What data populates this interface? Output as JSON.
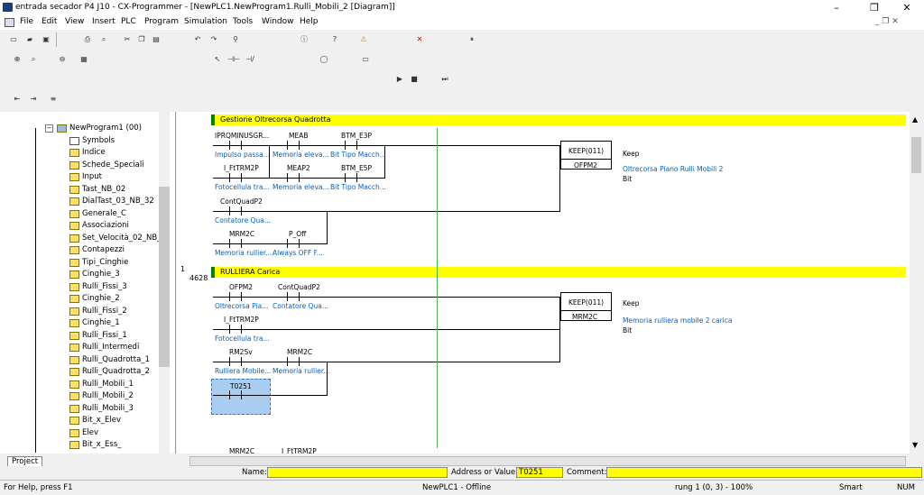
{
  "window": {
    "title": "entrada secador P4 J10 - CX-Programmer - [NewPLC1.NewProgram1.Rulli_Mobili_2 [Diagram]]",
    "controls": {
      "minimize": "–",
      "restore": "❐",
      "close": "✕"
    }
  },
  "menu": [
    "File",
    "Edit",
    "View",
    "Insert",
    "PLC",
    "Program",
    "Simulation",
    "Tools",
    "Window",
    "Help"
  ],
  "tree": {
    "root": "NewProgram1 (00)",
    "items": [
      "Symbols",
      "Indice",
      "Schede_Speciali",
      "Input",
      "Tast_NB_02",
      "DialTast_03_NB_32",
      "Generale_C",
      "Associazioni",
      "Set_Velocità_02_NB_3",
      "Contapezzi",
      "Tipi_Cinghie",
      "Cinghie_3",
      "Rulli_Fissi_3",
      "Cinghie_2",
      "Rulli_Fissi_2",
      "Cinghie_1",
      "Rulli_Fissi_1",
      "Rulli_Intermedi",
      "Rulli_Quadrotta_1",
      "Rulli_Quadrotta_2",
      "Rulli_Mobili_1",
      "Rulli_Mobili_2",
      "Rulli_Mobili_3",
      "Bit_x_Elev",
      "Elev",
      "Bit_x_Ess_"
    ],
    "tab": "Project"
  },
  "rungs": [
    {
      "index": "",
      "step": "",
      "title": "Gestione Oltrecorsa Quadrotta",
      "contacts": [
        {
          "addr": "IPRQMINUSGR...",
          "comment": "Impulso passa..."
        },
        {
          "addr": "MEAB",
          "comment": "Memoria eleva..."
        },
        {
          "addr": "BTM_E3P",
          "comment": "Bit Tipo Macch..."
        },
        {
          "addr": "I_FtTRM2P",
          "comment": "Fotocellula tra..."
        },
        {
          "addr": "MEAP2",
          "comment": "Memoria eleva..."
        },
        {
          "addr": "BTM_E5P",
          "comment": "Bit Tipo Macch..."
        },
        {
          "addr": "ContQuadP2",
          "comment": "Contatore Qua..."
        },
        {
          "addr": "MRM2C",
          "comment": "Memoria rullier..."
        },
        {
          "addr": "P_Off",
          "comment": "Always OFF F..."
        }
      ],
      "instruction": "KEEP(011)",
      "operand": "OFPM2",
      "instr_comment": "Keep",
      "operand_comment": "Oltrecorsa Piano Rulli Mobili 2",
      "operand_type": "Bit"
    },
    {
      "index": "1",
      "step": "4628",
      "title": "RULLIERA Carica",
      "contacts": [
        {
          "addr": "OFPM2",
          "comment": "Oltrecorsa Pia..."
        },
        {
          "addr": "ContQuadP2",
          "comment": "Contatore Qua..."
        },
        {
          "addr": "I_FtTRM2P",
          "comment": "Fotocellula tra..."
        },
        {
          "addr": "RM2Sv",
          "comment": "Rulliera Mobile..."
        },
        {
          "addr": "MRM2C",
          "comment": "Memoria rullier..."
        },
        {
          "addr": "T0251",
          "comment": ""
        }
      ],
      "instruction": "KEEP(011)",
      "operand": "MRM2C",
      "instr_comment": "Keep",
      "operand_comment": "Memoria rulliera mobile 2 carica",
      "operand_type": "Bit"
    }
  ],
  "next_rung": {
    "contacts": [
      "MRM2C",
      "I_FtTRM2P"
    ]
  },
  "find_bar": {
    "name_label": "Name:",
    "name_value": "",
    "addr_label": "Address or Value:",
    "addr_value": "T0251",
    "comment_label": "Comment:",
    "comment_value": ""
  },
  "status": {
    "help": "For Help, press F1",
    "plc": "NewPLC1 - Offline",
    "rung": "rung 1 (0, 3) - 100%",
    "mode": "Smart",
    "num": "NUM"
  },
  "colors": {
    "rung_header": "#ffff00",
    "rail": "#4caf50",
    "comment": "#0060c0",
    "selection": "#a9cdf0"
  }
}
